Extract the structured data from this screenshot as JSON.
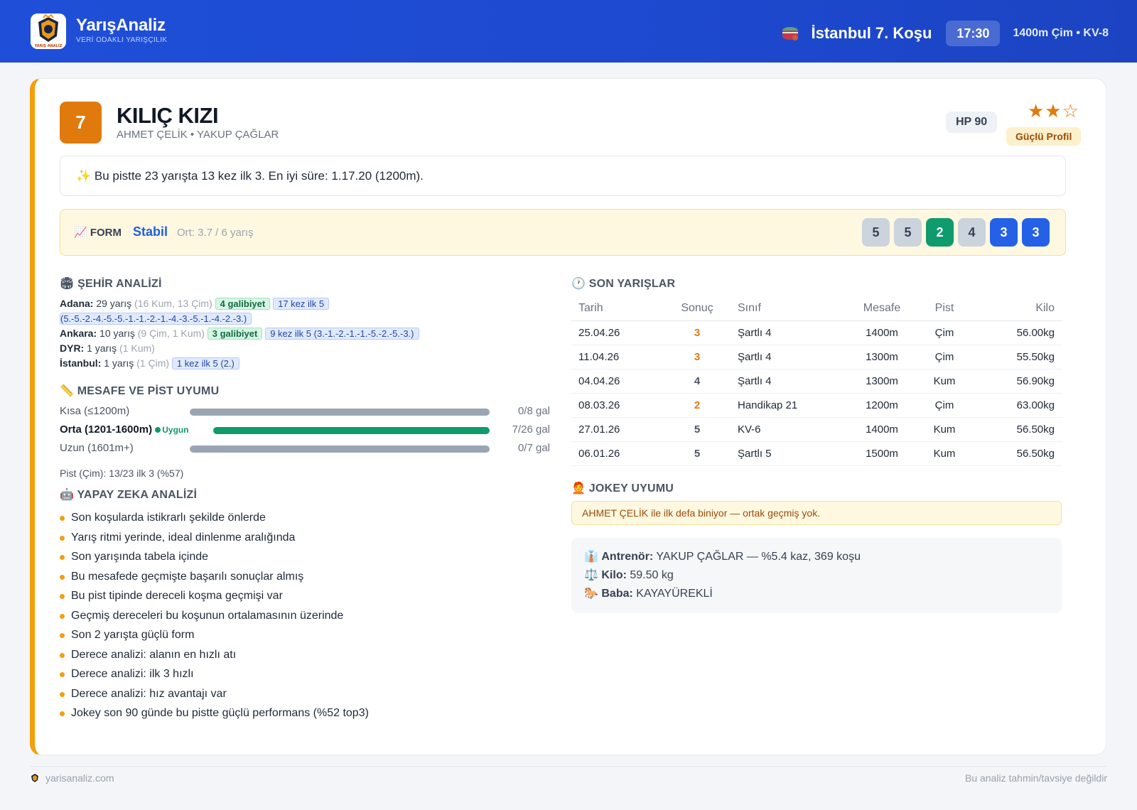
{
  "header": {
    "brand": "YarışAnaliz",
    "tagline": "VERİ ODAKLI YARIŞÇILIK",
    "race_title": "İstanbul 7. Koşu",
    "race_time": "17:30",
    "race_info": "1400m Çim • KV-8",
    "logo_text": "YARIŞ ANALİZ"
  },
  "horse": {
    "number": "7",
    "name": "KILIÇ KIZI",
    "connections": "AHMET ÇELİK • YAKUP ÇAĞLAR",
    "hp": "HP 90",
    "stars_filled": "★★",
    "stars_empty": "☆",
    "rating": 2,
    "rating_max": 3,
    "profile": "Güçlü Profil"
  },
  "highlight": "✨ Bu pistte 23 yarışta 13 kez ilk 3. En iyi süre: 1.17.20 (1200m).",
  "form": {
    "label": "📈 FORM",
    "status": "Stabil",
    "avg": "Ort: 3.7 / 6 yarış",
    "results": [
      "5",
      "5",
      "2",
      "4",
      "3",
      "3"
    ]
  },
  "city": {
    "title": "🏟 ŞEHİR ANALİZİ",
    "rows": [
      {
        "city": "Adana:",
        "races": "29 yarış",
        "detail": "(16 Kum, 13 Çim)",
        "wins": "4 galibiyet",
        "top5": "17 kez ilk 5",
        "top5_detail": "(5.-5.-2.-4.-5.-5.-1.-1.-2.-1.-4.-3.-5.-1.-4.-2.-3.)"
      },
      {
        "city": "Ankara:",
        "races": "10 yarış",
        "detail": "(9 Çim, 1 Kum)",
        "wins": "3 galibiyet",
        "top5": "9 kez ilk 5 (3.-1.-2.-1.-1.-5.-2.-5.-3.)"
      },
      {
        "city": "DYR:",
        "races": "1 yarış",
        "detail": "(1 Kum)"
      },
      {
        "city": "İstanbul:",
        "races": "1 yarış",
        "detail": "(1 Çim)",
        "top5": "1 kez ilk 5 (2.)"
      }
    ]
  },
  "distance": {
    "title": "📏 MESAFE VE PİST UYUMU",
    "rows": [
      {
        "label": "Kısa (≤1200m)",
        "value": "0/8 gal",
        "fill": 1.0,
        "color": "#9aa5b4"
      },
      {
        "label": "Orta (1201-1600m)",
        "badge": "Uygun",
        "value": "7/26 gal",
        "fill": 1.0,
        "color": "#0f9b6b"
      },
      {
        "label": "Uzun (1601m+)",
        "value": "0/7 gal",
        "fill": 1.0,
        "color": "#9aa5b4"
      }
    ],
    "pist": "Pist (Çim): 13/23 ilk 3 (%57)"
  },
  "ai": {
    "title": "🤖 YAPAY ZEKA ANALİZİ",
    "items": [
      "Son koşularda istikrarlı şekilde önlerde",
      "Yarış ritmi yerinde, ideal dinlenme aralığında",
      "Son yarışında tabela içinde",
      "Bu mesafede geçmişte başarılı sonuçlar almış",
      "Bu pist tipinde dereceli koşma geçmişi var",
      "Geçmiş dereceleri bu koşunun ortalamasının üzerinde",
      "Son 2 yarışta güçlü form",
      "Derece analizi: alanın en hızlı atı",
      "Derece analizi: ilk 3 hızlı",
      "Derece analizi: hız avantajı var",
      "Jokey son 90 günde bu pistte güçlü performans (%52 top3)"
    ]
  },
  "recent": {
    "title": "🕐 SON YARIŞLAR",
    "columns": [
      "Tarih",
      "Sonuç",
      "Sınıf",
      "Mesafe",
      "Pist",
      "Kilo"
    ],
    "rows": [
      [
        "25.04.26",
        "3",
        "Şartlı 4",
        "1400m",
        "Çim",
        "56.00kg"
      ],
      [
        "11.04.26",
        "3",
        "Şartlı 4",
        "1300m",
        "Çim",
        "55.50kg"
      ],
      [
        "04.04.26",
        "4",
        "Şartlı 4",
        "1300m",
        "Kum",
        "56.90kg"
      ],
      [
        "08.03.26",
        "2",
        "Handikap 21",
        "1200m",
        "Çim",
        "63.00kg"
      ],
      [
        "27.01.26",
        "5",
        "KV-6",
        "1400m",
        "Kum",
        "56.50kg"
      ],
      [
        "06.01.26",
        "5",
        "Şartlı 5",
        "1500m",
        "Kum",
        "56.50kg"
      ]
    ]
  },
  "jockey": {
    "title": "🧑‍🦰 JOKEY UYUMU",
    "note": "AHMET ÇELİK ile ilk defa biniyor — ortak geçmiş yok."
  },
  "info": {
    "trainer_label": "Antrenör:",
    "trainer_value": "YAKUP ÇAĞLAR — %5.4 kaz, 369 koşu",
    "weight_label": "Kilo:",
    "weight_value": "59.50 kg",
    "sire_label": "Baba:",
    "sire_value": "KAYAYÜREKLİ"
  },
  "footer": {
    "site": "yarisanaliz.com",
    "disclaimer": "Bu analiz tahmin/tavsiye değildir"
  },
  "colors": {
    "accent": "#f59e0b",
    "header_blue": "#1f4fd8",
    "win_green": "#0f9b6b",
    "place_blue": "#2461e6"
  }
}
